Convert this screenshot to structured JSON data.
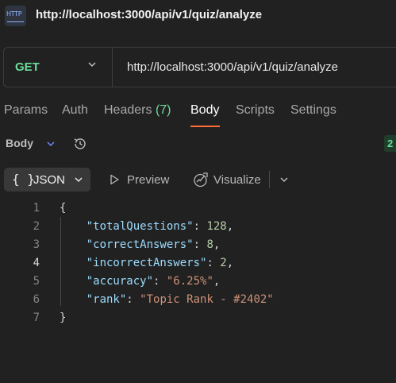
{
  "window": {
    "icon_label": "HTTP",
    "title": "http://localhost:3000/api/v1/quiz/analyze"
  },
  "request": {
    "method": "GET",
    "url": "http://localhost:3000/api/v1/quiz/analyze"
  },
  "tabs": [
    {
      "label": "Params"
    },
    {
      "label": "Auth"
    },
    {
      "label": "Headers",
      "count": "(7)"
    },
    {
      "label": "Body",
      "active": true
    },
    {
      "label": "Scripts"
    },
    {
      "label": "Settings"
    }
  ],
  "response": {
    "section_label": "Body",
    "status_partial": "2",
    "view_mode": "JSON",
    "view_braces": "{ }",
    "preview_label": "Preview",
    "visualize_label": "Visualize"
  },
  "code": {
    "line_numbers": [
      "1",
      "2",
      "3",
      "4",
      "5",
      "6",
      "7"
    ],
    "open_brace": "{",
    "close_brace": "}",
    "fields": [
      {
        "key": "\"totalQuestions\"",
        "value": "128",
        "type": "number"
      },
      {
        "key": "\"correctAnswers\"",
        "value": "8",
        "type": "number"
      },
      {
        "key": "\"incorrectAnswers\"",
        "value": "2",
        "type": "number"
      },
      {
        "key": "\"accuracy\"",
        "value": "\"6.25%\"",
        "type": "string"
      },
      {
        "key": "\"rank\"",
        "value": "\"Topic Rank - #2402\"",
        "type": "string"
      }
    ]
  },
  "colors": {
    "method_get": "#6bdd9a",
    "tab_underline": "#ff6c37",
    "json_key": "#9cdcfe",
    "json_number": "#b5cea8",
    "json_string": "#ce9178"
  }
}
